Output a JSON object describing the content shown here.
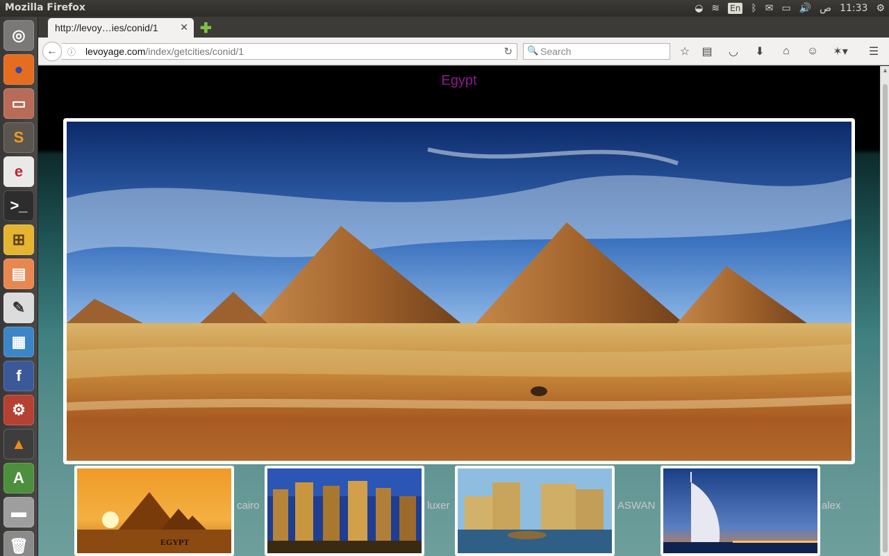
{
  "system": {
    "window_title": "Mozilla Firefox",
    "keyboard_layout": "En",
    "am_pm": "ص",
    "clock": "11:33"
  },
  "launcher": {
    "items": [
      {
        "name": "dash-icon",
        "glyph": "◎",
        "bg": "#7a7977",
        "fg": "#ffffff"
      },
      {
        "name": "firefox-icon",
        "glyph": "●",
        "bg": "#e46d1f",
        "fg": "#2d4aa6"
      },
      {
        "name": "files-icon",
        "glyph": "▭",
        "bg": "#b86b57",
        "fg": "#ffffff"
      },
      {
        "name": "sublime-text-icon",
        "glyph": "S",
        "bg": "#5b5550",
        "fg": "#f39a22"
      },
      {
        "name": "browser-e-icon",
        "glyph": "e",
        "bg": "#e9e9e9",
        "fg": "#c2262e"
      },
      {
        "name": "terminal-icon",
        "glyph": ">_",
        "bg": "#2d2d2d",
        "fg": "#ffffff"
      },
      {
        "name": "network-manager-icon",
        "glyph": "⊞",
        "bg": "#e5b531",
        "fg": "#5b3c10"
      },
      {
        "name": "impress-icon",
        "glyph": "▤",
        "bg": "#e8874f",
        "fg": "#ffffff"
      },
      {
        "name": "text-editor-icon",
        "glyph": "✎",
        "bg": "#dcdcdc",
        "fg": "#333333"
      },
      {
        "name": "writer-icon",
        "glyph": "▦",
        "bg": "#3c85c7",
        "fg": "#ffffff"
      },
      {
        "name": "facebook-icon",
        "glyph": "f",
        "bg": "#3b5998",
        "fg": "#ffffff"
      },
      {
        "name": "system-settings-icon",
        "glyph": "⚙",
        "bg": "#b54034",
        "fg": "#ffffff"
      },
      {
        "name": "vlc-icon",
        "glyph": "▲",
        "bg": "#3d3d3d",
        "fg": "#f08a1b"
      },
      {
        "name": "software-updater-icon",
        "glyph": "A",
        "bg": "#4d8f3c",
        "fg": "#ffffff"
      },
      {
        "name": "drive-icon",
        "glyph": "▬",
        "bg": "#9e9e9e",
        "fg": "#ffffff"
      },
      {
        "name": "trash-icon",
        "glyph": "🗑",
        "bg": "#8a8a8a",
        "fg": "#ffffff"
      }
    ]
  },
  "browser": {
    "tab_title": "http://levoy…ies/conid/1",
    "url_host": "levoyage.com",
    "url_path": "/index/getcities/conid/1",
    "search_placeholder": "Search"
  },
  "page": {
    "heading": "Egypt",
    "heading_color": "#8e1a8a",
    "cities": [
      {
        "label": "cairo",
        "caption": "EGYPT"
      },
      {
        "label": "luxer"
      },
      {
        "label": "ASWAN"
      },
      {
        "label": "alex"
      }
    ]
  }
}
